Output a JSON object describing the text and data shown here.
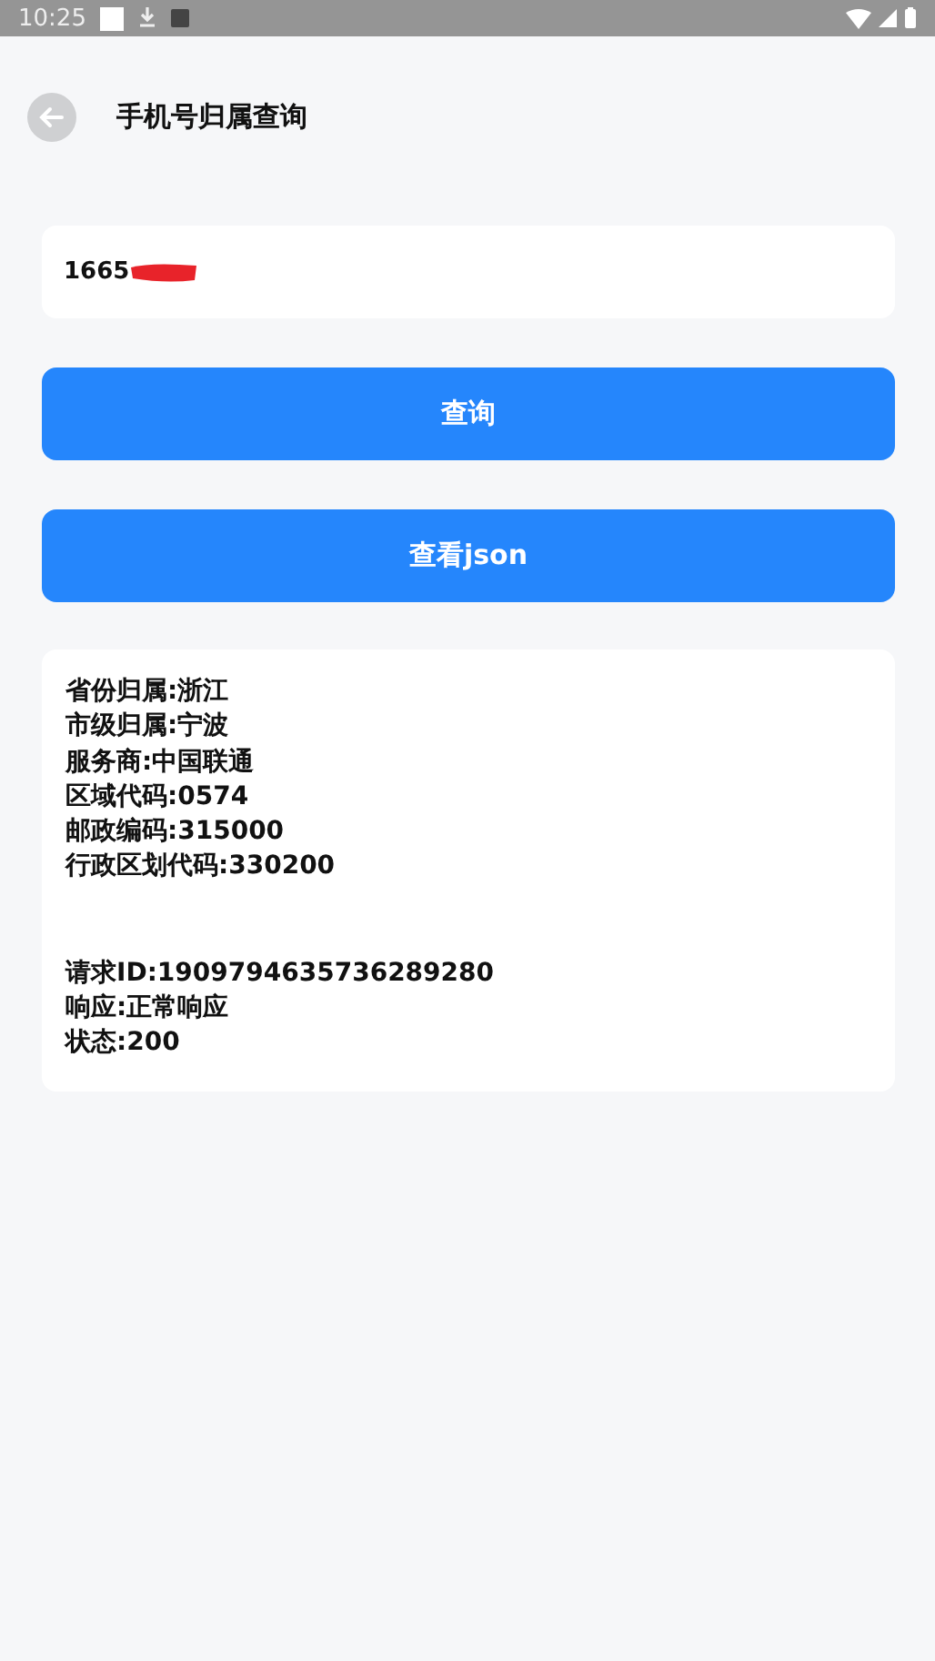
{
  "status_bar": {
    "time": "10:25"
  },
  "header": {
    "title": "手机号归属查询"
  },
  "phone_input": {
    "value": "1665"
  },
  "buttons": [
    "查询",
    "查看json"
  ],
  "result": {
    "location_lines": [
      "省份归属:浙江",
      "市级归属:宁波",
      "服务商:中国联通",
      "区域代码:0574",
      "邮政编码:315000",
      "行政区划代码:330200"
    ],
    "response_lines": [
      "请求ID:1909794635736289280",
      "响应:正常响应",
      "状态:200"
    ]
  }
}
